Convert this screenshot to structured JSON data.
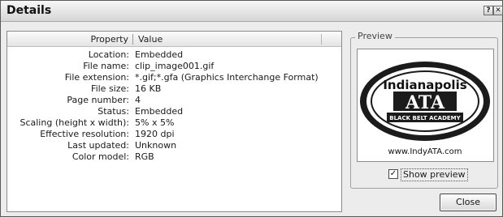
{
  "window": {
    "title": "Details",
    "help_glyph": "?",
    "close_glyph": "✕"
  },
  "table": {
    "headers": {
      "property": "Property",
      "value": "Value"
    },
    "rows": [
      {
        "property": "Location:",
        "value": "Embedded"
      },
      {
        "property": "File name:",
        "value": "clip_image001.gif"
      },
      {
        "property": "File extension:",
        "value": "*.gif;*.gfa (Graphics Interchange Format)"
      },
      {
        "property": "File size:",
        "value": "16 KB"
      },
      {
        "property": "Page number:",
        "value": "4"
      },
      {
        "property": "Status:",
        "value": "Embedded"
      },
      {
        "property": "Scaling (height x width):",
        "value": "5% x 5%"
      },
      {
        "property": "Effective resolution:",
        "value": "1920 dpi"
      },
      {
        "property": "Last updated:",
        "value": "Unknown"
      },
      {
        "property": "Color model:",
        "value": "RGB"
      }
    ]
  },
  "preview": {
    "group_label": "Preview",
    "logo_top_text": "Indianapolis",
    "logo_mid_text": "ATA",
    "logo_band_text": "BLACK BELT ACADEMY",
    "logo_url_text": "www.IndyATA.com",
    "show_preview_label": "Show preview",
    "show_preview_checked": true,
    "check_glyph": "✓"
  },
  "buttons": {
    "close_label": "Close"
  }
}
